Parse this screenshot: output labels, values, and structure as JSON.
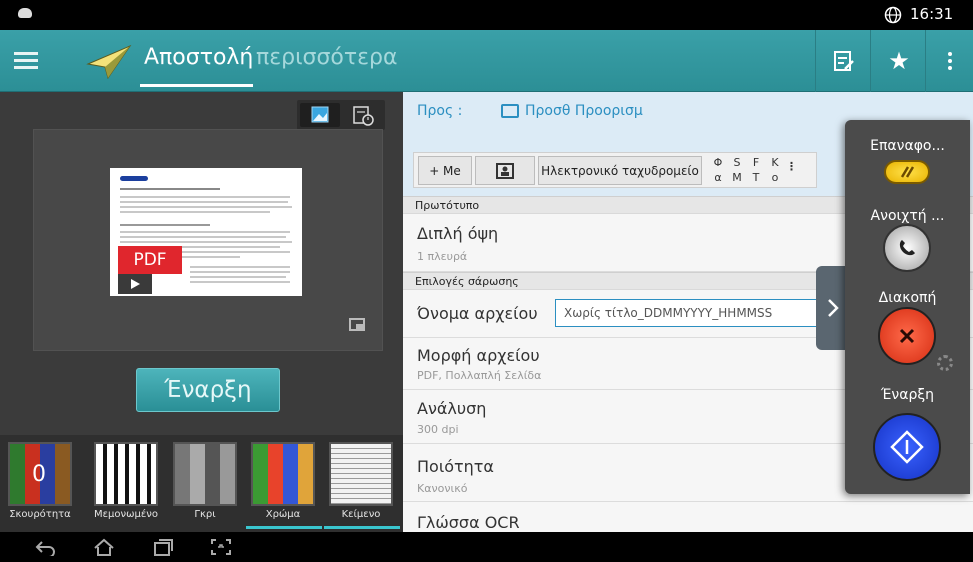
{
  "status": {
    "time": "16:31"
  },
  "actionbar": {
    "title": "Αποστολή",
    "more_label": "περισσότερα"
  },
  "to_section": {
    "label": "Προς :",
    "add_label": "Προσθ Προορισμ"
  },
  "to_buttons": {
    "me": "+ Me",
    "email": "Ηλεκτρονικό ταχυδρομείο",
    "short": [
      {
        "top": "Φ",
        "bottom": "α"
      },
      {
        "top": "S",
        "bottom": "M"
      },
      {
        "top": "F",
        "bottom": "T"
      },
      {
        "top": "K",
        "bottom": "o"
      }
    ]
  },
  "sections": {
    "original": "Πρωτότυπο",
    "scan_options": "Επιλογές σάρωσης"
  },
  "rows": {
    "duplex": {
      "title": "Διπλή όψη",
      "value": "1 πλευρά"
    },
    "filename": {
      "title": "Όνομα αρχείου",
      "value": "Χωρίς τίτλο_DDMMYYYY_HHMMSS"
    },
    "format": {
      "title": "Μορφή αρχείου",
      "value": "PDF, Πολλαπλή Σελίδα"
    },
    "resolution": {
      "title": "Ανάλυση",
      "value": "300 dpi"
    },
    "quality": {
      "title": "Ποιότητα",
      "value": "Κανονικό"
    },
    "ocr": {
      "title": "Γλώσσα OCR"
    }
  },
  "preview": {
    "badge": "PDF",
    "start_label": "Έναρξη"
  },
  "color_modes": {
    "darkness_value": "0",
    "items": [
      {
        "label": "Σκουρότητα"
      },
      {
        "label": "Μεμονωμένο"
      },
      {
        "label": "Γκρι"
      },
      {
        "label": "Χρώμα"
      },
      {
        "label": "Κείμενο"
      }
    ]
  },
  "drawer": {
    "reset": "Επαναφο...",
    "open": "Ανοιχτή ...",
    "stop": "Διακοπή",
    "start": "Έναρξη"
  },
  "colors": {
    "accent": "#2c8f96",
    "link": "#2b8fc1"
  }
}
